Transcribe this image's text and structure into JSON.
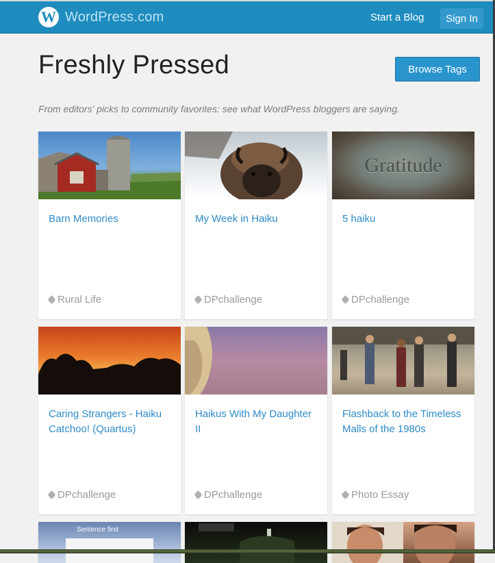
{
  "header": {
    "brand": "WordPress.com",
    "logo_letter": "W",
    "start_blog": "Start a Blog",
    "sign_in": "Sign In"
  },
  "page": {
    "title": "Freshly Pressed",
    "browse_tags": "Browse Tags",
    "subtitle": "From editors' picks to community favorites: see what WordPress bloggers are saying."
  },
  "posts": [
    {
      "title": "Barn Memories",
      "tag": "Rural Life",
      "image": "barn-photo"
    },
    {
      "title": "My Week in Haiku",
      "tag": "DPchallenge",
      "image": "bison-photo"
    },
    {
      "title": "5 haiku",
      "tag": "DPchallenge",
      "image": "gratitude-stone-photo",
      "image_text": "Gratitude"
    },
    {
      "title": "Caring Strangers - Haiku Catchoo! (Quartus)",
      "tag": "DPchallenge",
      "image": "sunset-trees-photo"
    },
    {
      "title": "Haikus With My Daughter II",
      "tag": "DPchallenge",
      "image": "girl-profile-photo"
    },
    {
      "title": "Flashback to the Timeless Malls of the 1980s",
      "tag": "Photo Essay",
      "image": "mall-crowd-photo"
    }
  ],
  "partial_posts": [
    {
      "image": "blog-screenshot-photo",
      "image_text": "Sentence first"
    },
    {
      "image": "forest-photo"
    },
    {
      "image": "portrait-photo"
    }
  ],
  "colors": {
    "header": "#1e8cbe",
    "accent_link": "#2e8ac6",
    "button": "#2a94cd"
  }
}
